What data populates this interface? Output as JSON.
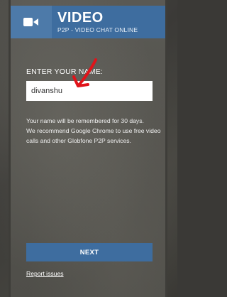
{
  "header": {
    "title": "VIDEO",
    "subtitle": "P2P - VIDEO CHAT ONLINE",
    "icon": "video-camera-icon",
    "colors": {
      "icon_bg": "#4d7aa9",
      "title_bg": "#3e6d9f"
    }
  },
  "form": {
    "label": "ENTER YOUR NAME:",
    "name_value": "divanshu"
  },
  "info": {
    "line1": "Your name will be remembered for 30 days.",
    "line2": "We recommend Google Chrome to use free video calls and other Globfone P2P services."
  },
  "actions": {
    "next_label": "NEXT",
    "report_label": "Report issues"
  },
  "annotation": {
    "icon": "red-arrow-icon",
    "color": "#e0141a"
  }
}
